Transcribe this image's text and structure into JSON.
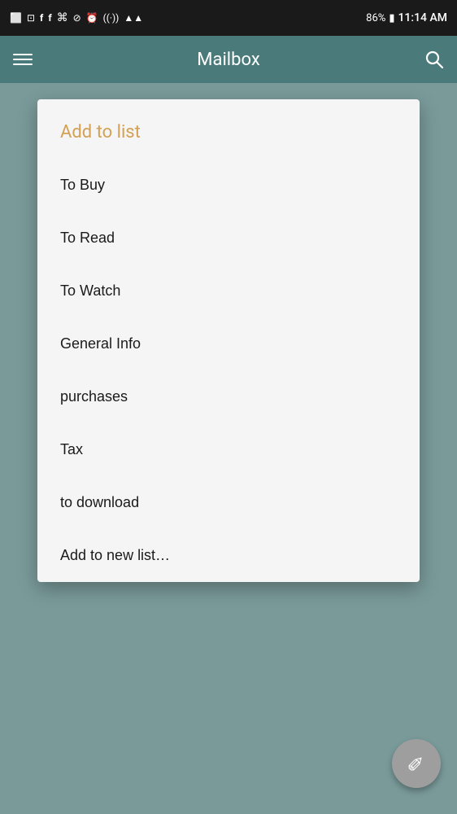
{
  "statusBar": {
    "time": "11:14 AM",
    "battery": "86%",
    "icons": [
      "▣",
      "⊡",
      "f",
      "f",
      "⌘",
      "⊘",
      "⏰",
      "wifi",
      "▲",
      "battery"
    ]
  },
  "appBar": {
    "title": "Mailbox",
    "menuIcon": "menu",
    "searchIcon": "search"
  },
  "dialog": {
    "title": "Add to list",
    "items": [
      "To Buy",
      "To Read",
      "To Watch",
      "General Info",
      "purchases",
      "Tax",
      "to download",
      "Add to new list…"
    ]
  },
  "fab": {
    "icon": "✏"
  }
}
